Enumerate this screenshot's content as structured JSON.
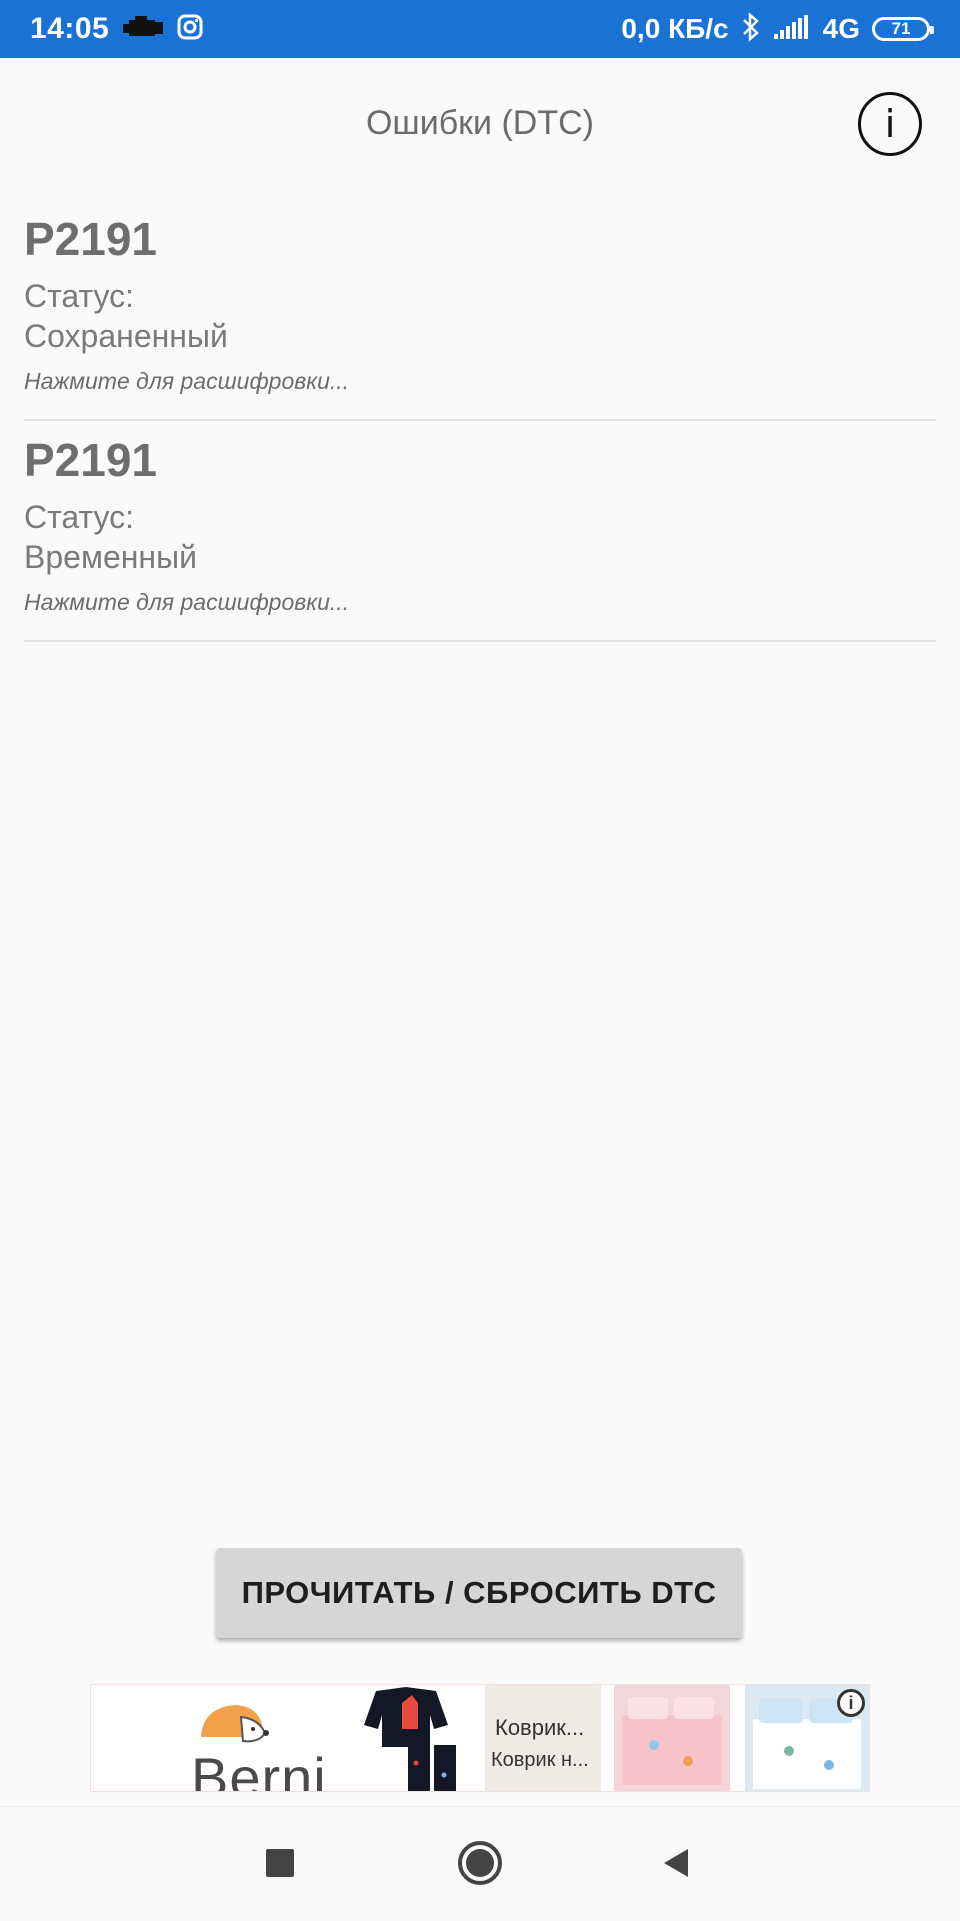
{
  "status_bar": {
    "time": "14:05",
    "net_speed": "0,0 КБ/с",
    "network": "4G",
    "battery": "71",
    "icons": [
      "car-engine-icon",
      "instagram-icon",
      "bluetooth-icon",
      "signal-icon"
    ]
  },
  "header": {
    "title": "Ошибки (DTC)",
    "info_icon": "i"
  },
  "dtc_list": [
    {
      "code": "P2191",
      "status_label": "Статус:",
      "status_value": "Сохраненный",
      "hint": "Нажмите для расшифровки..."
    },
    {
      "code": "P2191",
      "status_label": "Статус:",
      "status_value": "Временный",
      "hint": "Нажмите для расшифровки..."
    }
  ],
  "action_button": {
    "label": "ПРОЧИТАТЬ / СБРОСИТЬ DTC"
  },
  "ad": {
    "brand": "Berni",
    "rug_title": "Коврик...",
    "rug_subtitle": "Коврик н...",
    "info_icon": "i"
  },
  "colors": {
    "status_bar": "#1a73d4",
    "background": "#fafafa",
    "button": "#d6d6d6"
  }
}
